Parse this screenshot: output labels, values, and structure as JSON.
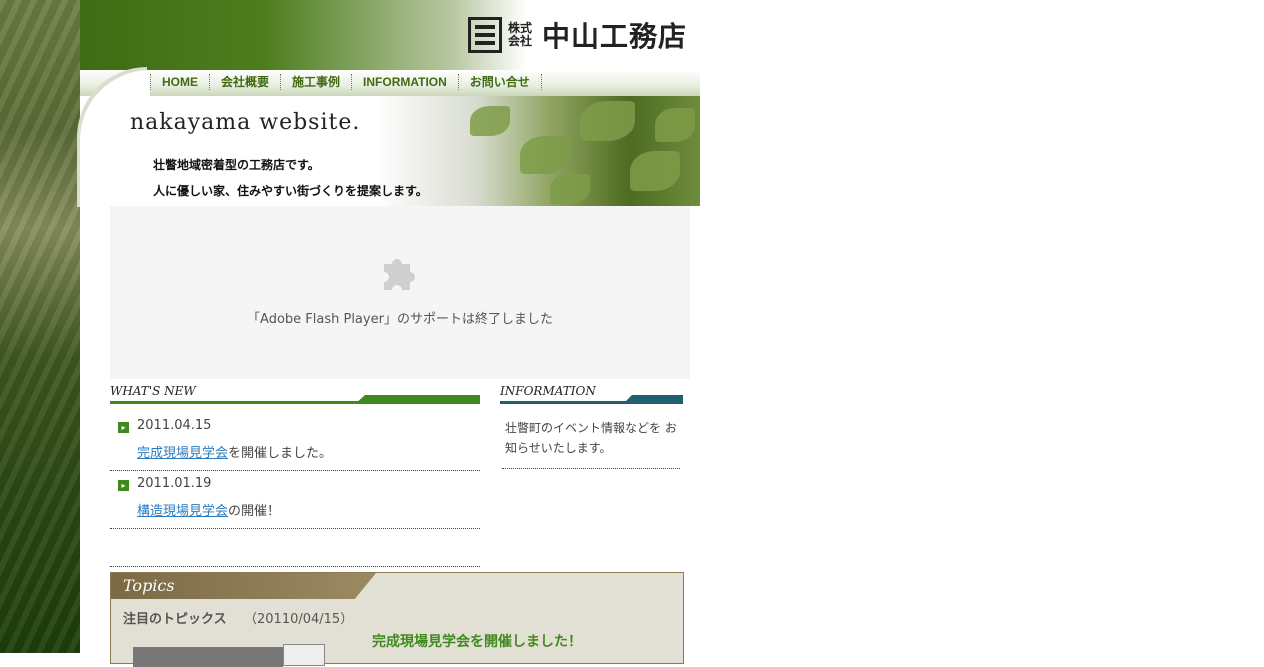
{
  "header": {
    "logo_corp": "株式会社",
    "logo_name": "中山工務店"
  },
  "nav": {
    "items": [
      "HOME",
      "会社概要",
      "施工事例",
      "INFORMATION",
      "お問い合せ"
    ]
  },
  "hero": {
    "title": "nakayama  website.",
    "line1": "壮瞥地域密着型の工務店です。",
    "line2": "人に優しい家、住みやすい街づくりを提案します。"
  },
  "flash": {
    "icon": "puzzle-icon",
    "message": "「Adobe Flash Player」のサポートは終了しました"
  },
  "whats_new": {
    "label": "WHAT'S NEW",
    "accent": "#3f8a1e",
    "items": [
      {
        "date": "2011.04.15",
        "link": "完成現場見学会",
        "rest": "を開催しました。"
      },
      {
        "date": "2011.01.19",
        "link": "構造現場見学会",
        "rest": "の開催！"
      }
    ]
  },
  "information": {
    "label": "INFORMATION",
    "accent": "#1f5f70",
    "text": "壮瞥町のイベント情報などを お知らせいたします。"
  },
  "topics": {
    "title": "Topics",
    "subtitle": "注目のトピックス",
    "date": "（20110/04/15）",
    "headline": "完成現場見学会を開催しました！"
  }
}
